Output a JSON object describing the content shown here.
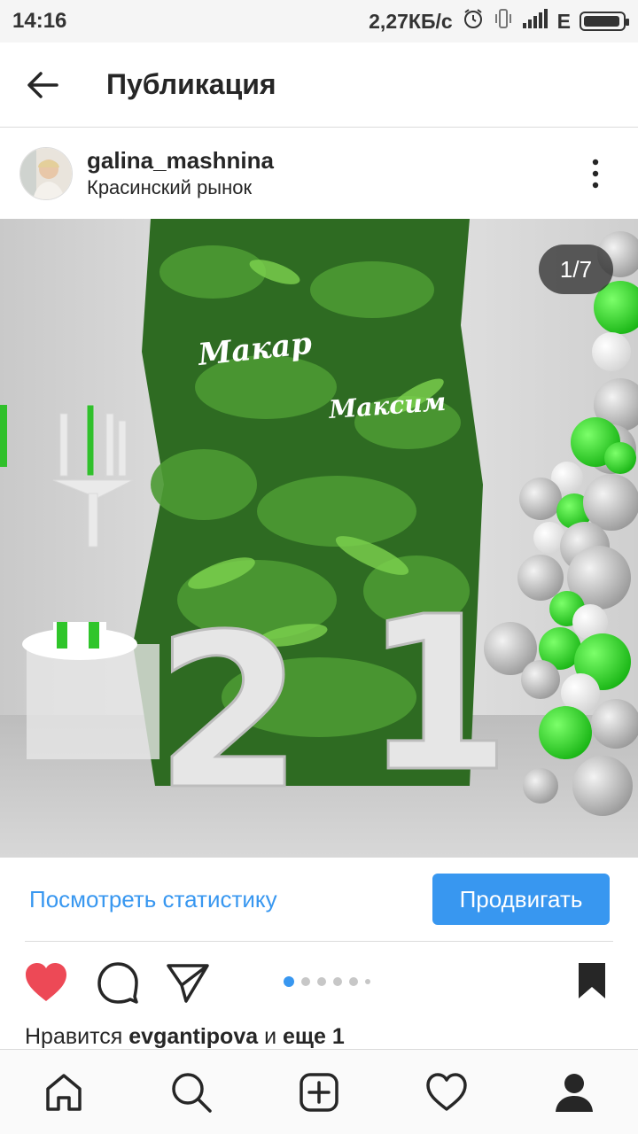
{
  "status_bar": {
    "time": "14:16",
    "net_speed": "2,27КБ/с",
    "network_type": "E",
    "icons": [
      "alarm-icon",
      "vibrate-icon",
      "signal-icon",
      "battery-icon"
    ]
  },
  "header": {
    "title": "Публикация",
    "back_icon": "arrow-left-icon"
  },
  "post": {
    "username": "galina_mashnina",
    "location": "Красинский рынок",
    "more_icon": "kebab-menu-icon",
    "counter": "1/7",
    "photo_texts": [
      "Макар",
      "Максим"
    ],
    "photo_numbers": [
      "2",
      "1"
    ]
  },
  "insights": {
    "stats_label": "Посмотреть статистику",
    "promote_label": "Продвигать"
  },
  "actions": {
    "icons": [
      "heart-filled-icon",
      "comment-icon",
      "share-icon",
      "bookmark-icon"
    ],
    "like_color": "#ed4956",
    "accent": "#3897f0",
    "carousel_dots": 6,
    "carousel_active_index": 0
  },
  "likes": {
    "prefix": "Нравится ",
    "user": "evgantipova",
    "middle": " и ",
    "suffix": "еще 1"
  },
  "bottom_nav": {
    "items": [
      "home-icon",
      "search-icon",
      "new-post-icon",
      "activity-icon",
      "profile-icon"
    ]
  }
}
